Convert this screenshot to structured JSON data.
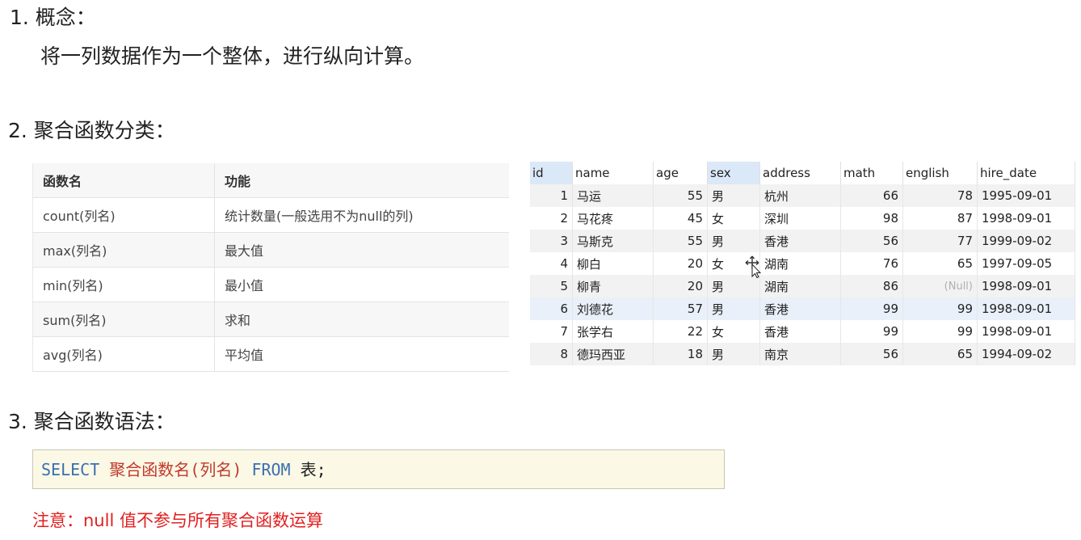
{
  "sections": {
    "concept": {
      "heading": "1. 概念：",
      "text": "将一列数据作为一个整体，进行纵向计算。"
    },
    "classification": {
      "heading": "2. 聚合函数分类："
    },
    "syntax": {
      "heading": "3. 聚合函数语法："
    }
  },
  "functions_table": {
    "headers": [
      "函数名",
      "功能"
    ],
    "rows": [
      [
        "count(列名)",
        "统计数量(一般选用不为null的列)"
      ],
      [
        "max(列名)",
        "最大值"
      ],
      [
        "min(列名)",
        "最小值"
      ],
      [
        "sum(列名)",
        "求和"
      ],
      [
        "avg(列名)",
        "平均值"
      ]
    ]
  },
  "data_grid": {
    "columns": [
      "id",
      "name",
      "age",
      "sex",
      "address",
      "math",
      "english",
      "hire_date"
    ],
    "rows": [
      [
        "1",
        "马运",
        "55",
        "男",
        "杭州",
        "66",
        "78",
        "1995-09-01"
      ],
      [
        "2",
        "马花疼",
        "45",
        "女",
        "深圳",
        "98",
        "87",
        "1998-09-01"
      ],
      [
        "3",
        "马斯克",
        "55",
        "男",
        "香港",
        "56",
        "77",
        "1999-09-02"
      ],
      [
        "4",
        "柳白",
        "20",
        "女",
        "湖南",
        "76",
        "65",
        "1997-09-05"
      ],
      [
        "5",
        "柳青",
        "20",
        "男",
        "湖南",
        "86",
        "(Null)",
        "1998-09-01"
      ],
      [
        "6",
        "刘德花",
        "57",
        "男",
        "香港",
        "99",
        "99",
        "1998-09-01"
      ],
      [
        "7",
        "张学右",
        "22",
        "女",
        "香港",
        "99",
        "99",
        "1998-09-01"
      ],
      [
        "8",
        "德玛西亚",
        "18",
        "男",
        "南京",
        "56",
        "65",
        "1994-09-02"
      ]
    ]
  },
  "code": {
    "select": "SELECT",
    "func": "聚合函数名(列名)",
    "from": "FROM",
    "table": "表;"
  },
  "note": "注意：null 值不参与所有聚合函数运算"
}
